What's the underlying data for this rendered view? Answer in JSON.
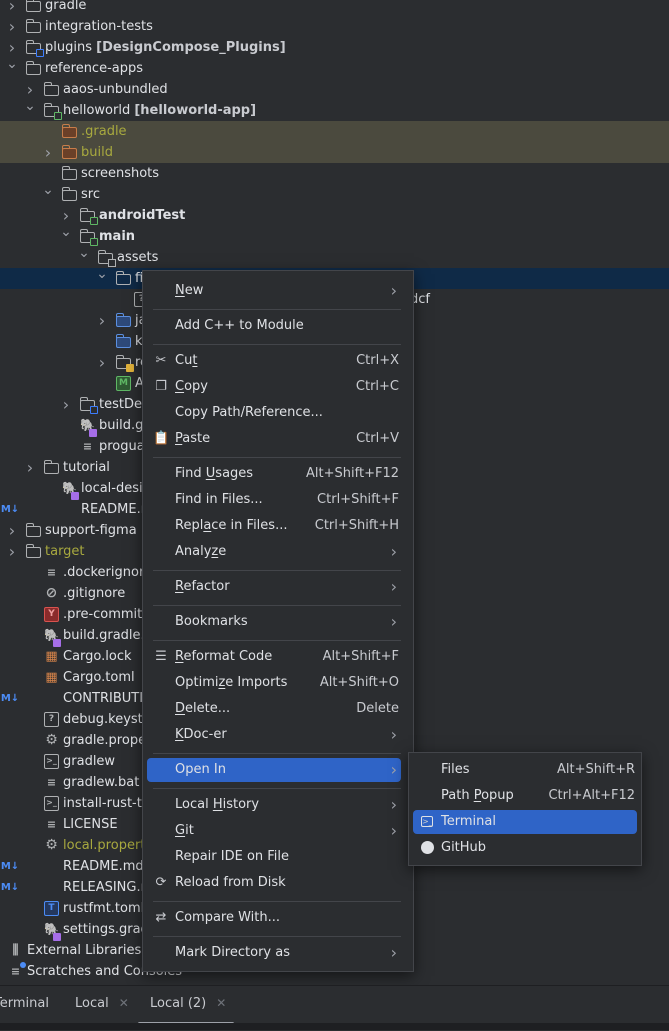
{
  "tree": {
    "rows": [
      {
        "label": "gradle",
        "indent": 0,
        "chevron": "right",
        "icon": "folder",
        "style": "normal"
      },
      {
        "label": "integration-tests",
        "indent": 0,
        "chevron": "right",
        "icon": "folder",
        "style": "normal"
      },
      {
        "label": "plugins",
        "module": "[DesignCompose_Plugins]",
        "indent": 0,
        "chevron": "right",
        "icon": "module-folder-blue",
        "style": "normal"
      },
      {
        "label": "reference-apps",
        "indent": 0,
        "chevron": "down",
        "icon": "folder",
        "style": "normal"
      },
      {
        "label": "aaos-unbundled",
        "indent": 1,
        "chevron": "right",
        "icon": "folder",
        "style": "normal"
      },
      {
        "label": "helloworld",
        "module": "[helloworld-app]",
        "indent": 1,
        "chevron": "down",
        "icon": "module-folder-green",
        "style": "normal"
      },
      {
        "label": ".gradle",
        "indent": 2,
        "chevron": "none",
        "icon": "folder-excluded",
        "style": "excluded"
      },
      {
        "label": "build",
        "indent": 2,
        "chevron": "right",
        "icon": "folder-excluded",
        "style": "excluded"
      },
      {
        "label": "screenshots",
        "indent": 2,
        "chevron": "none",
        "icon": "folder",
        "style": "normal"
      },
      {
        "label": "src",
        "indent": 2,
        "chevron": "down",
        "icon": "folder",
        "style": "normal"
      },
      {
        "label": "androidTest",
        "indent": 3,
        "chevron": "right",
        "icon": "module-folder-green",
        "style": "bold"
      },
      {
        "label": "main",
        "indent": 3,
        "chevron": "down",
        "icon": "module-folder-green",
        "style": "bold"
      },
      {
        "label": "assets",
        "indent": 4,
        "chevron": "down",
        "icon": "resource-folder",
        "style": "normal"
      },
      {
        "label": "fi",
        "indent": 5,
        "chevron": "down",
        "icon": "folder",
        "style": "selected"
      },
      {
        "label": "",
        "suffix": "dcf",
        "indent": 6,
        "chevron": "none",
        "icon": "unknown-file",
        "style": "normal"
      },
      {
        "label": "java",
        "indent": 5,
        "chevron": "right",
        "icon": "source-folder",
        "style": "normal"
      },
      {
        "label": "kotli",
        "indent": 5,
        "chevron": "none",
        "icon": "source-folder",
        "style": "normal"
      },
      {
        "label": "res",
        "indent": 5,
        "chevron": "right",
        "icon": "res-folder",
        "style": "normal"
      },
      {
        "label": "And",
        "indent": 5,
        "chevron": "none",
        "icon": "manifest-file",
        "style": "normal"
      },
      {
        "label": "testDel",
        "indent": 3,
        "chevron": "right",
        "icon": "module-folder-blue",
        "style": "normal"
      },
      {
        "label": "build.grad",
        "indent": 3,
        "chevron": "none",
        "icon": "gradle-kts-file",
        "style": "normal"
      },
      {
        "label": "proguard-",
        "indent": 3,
        "chevron": "none",
        "icon": "text-file",
        "style": "normal"
      },
      {
        "label": "tutorial",
        "indent": 1,
        "chevron": "right",
        "icon": "folder",
        "style": "normal"
      },
      {
        "label": "local-design-",
        "indent": 2,
        "chevron": "none",
        "icon": "gradle-kts-file",
        "style": "normal"
      },
      {
        "label": "README.md",
        "indent": 2,
        "chevron": "none",
        "icon": "markdown-file",
        "style": "normal"
      },
      {
        "label": "support-figma",
        "indent": 0,
        "chevron": "right",
        "icon": "folder",
        "style": "normal"
      },
      {
        "label": "target",
        "indent": 0,
        "chevron": "right",
        "icon": "folder",
        "style": "olive"
      },
      {
        "label": ".dockerignore",
        "indent": 1,
        "chevron": "none",
        "icon": "text-file",
        "style": "normal"
      },
      {
        "label": ".gitignore",
        "indent": 1,
        "chevron": "none",
        "icon": "ignore-file",
        "style": "normal"
      },
      {
        "label": ".pre-commit-co",
        "indent": 1,
        "chevron": "none",
        "icon": "yaml-file",
        "style": "normal"
      },
      {
        "label": "build.gradle.kts",
        "indent": 1,
        "chevron": "none",
        "icon": "gradle-kts-file",
        "style": "normal"
      },
      {
        "label": "Cargo.lock",
        "indent": 1,
        "chevron": "none",
        "icon": "cargo-lock-file",
        "style": "normal"
      },
      {
        "label": "Cargo.toml",
        "indent": 1,
        "chevron": "none",
        "icon": "cargo-file",
        "style": "normal"
      },
      {
        "label": "CONTRIBUTING",
        "indent": 1,
        "chevron": "none",
        "icon": "markdown-file",
        "style": "normal"
      },
      {
        "label": "debug.keystore",
        "indent": 1,
        "chevron": "none",
        "icon": "unknown-file",
        "style": "normal"
      },
      {
        "label": "gradle.propertie",
        "indent": 1,
        "chevron": "none",
        "icon": "gear-file",
        "style": "normal"
      },
      {
        "label": "gradlew",
        "indent": 1,
        "chevron": "none",
        "icon": "shell-file",
        "style": "normal"
      },
      {
        "label": "gradlew.bat",
        "indent": 1,
        "chevron": "none",
        "icon": "text-file",
        "style": "normal"
      },
      {
        "label": "install-rust-tool",
        "indent": 1,
        "chevron": "none",
        "icon": "shell-file",
        "style": "normal"
      },
      {
        "label": "LICENSE",
        "indent": 1,
        "chevron": "none",
        "icon": "text-file",
        "style": "normal"
      },
      {
        "label": "local.properties",
        "indent": 1,
        "chevron": "none",
        "icon": "gear-file",
        "style": "olive"
      },
      {
        "label": "README.md",
        "indent": 1,
        "chevron": "none",
        "icon": "markdown-file",
        "style": "normal"
      },
      {
        "label": "RELEASING.md",
        "indent": 1,
        "chevron": "none",
        "icon": "markdown-file",
        "style": "normal"
      },
      {
        "label": "rustfmt.toml",
        "indent": 1,
        "chevron": "none",
        "icon": "toml-file",
        "style": "normal"
      },
      {
        "label": "settings.gradle.",
        "indent": 1,
        "chevron": "none",
        "icon": "gradle-kts-file",
        "style": "normal"
      },
      {
        "label": "External Libraries",
        "indent": -1,
        "chevron": "none",
        "icon": "libraries",
        "style": "normal"
      },
      {
        "label": "Scratches and Consoles",
        "indent": -1,
        "chevron": "none",
        "icon": "scratches",
        "style": "normal"
      }
    ]
  },
  "context_menu": {
    "items": [
      {
        "type": "item",
        "label": "New",
        "mnemonic": 0,
        "submenu": true
      },
      {
        "type": "sep"
      },
      {
        "type": "item",
        "label": "Add C++ to Module"
      },
      {
        "type": "sep"
      },
      {
        "type": "item",
        "label": "Cut",
        "mnemonic": 2,
        "shortcut": "Ctrl+X",
        "icon": "scissors-icon"
      },
      {
        "type": "item",
        "label": "Copy",
        "mnemonic": 0,
        "shortcut": "Ctrl+C",
        "icon": "copy-icon"
      },
      {
        "type": "item",
        "label": "Copy Path/Reference..."
      },
      {
        "type": "item",
        "label": "Paste",
        "mnemonic": 0,
        "shortcut": "Ctrl+V",
        "icon": "paste-icon"
      },
      {
        "type": "sep"
      },
      {
        "type": "item",
        "label": "Find Usages",
        "mnemonic": 5,
        "shortcut": "Alt+Shift+F12"
      },
      {
        "type": "item",
        "label": "Find in Files...",
        "shortcut": "Ctrl+Shift+F"
      },
      {
        "type": "item",
        "label": "Replace in Files...",
        "mnemonic": 4,
        "shortcut": "Ctrl+Shift+H"
      },
      {
        "type": "item",
        "label": "Analyze",
        "mnemonic": 5,
        "submenu": true
      },
      {
        "type": "sep"
      },
      {
        "type": "item",
        "label": "Refactor",
        "mnemonic": 0,
        "submenu": true
      },
      {
        "type": "sep"
      },
      {
        "type": "item",
        "label": "Bookmarks",
        "submenu": true
      },
      {
        "type": "sep"
      },
      {
        "type": "item",
        "label": "Reformat Code",
        "mnemonic": 0,
        "shortcut": "Alt+Shift+F",
        "icon": "reformat-icon"
      },
      {
        "type": "item",
        "label": "Optimize Imports",
        "mnemonic": 6,
        "shortcut": "Alt+Shift+O"
      },
      {
        "type": "item",
        "label": "Delete...",
        "mnemonic": 0,
        "shortcut": "Delete"
      },
      {
        "type": "item",
        "label": "KDoc-er",
        "mnemonic": 0,
        "submenu": true
      },
      {
        "type": "sep"
      },
      {
        "type": "item",
        "label": "Open In",
        "submenu": true,
        "active": true
      },
      {
        "type": "sep"
      },
      {
        "type": "item",
        "label": "Local History",
        "mnemonic": 6,
        "submenu": true
      },
      {
        "type": "item",
        "label": "Git",
        "mnemonic": 0,
        "submenu": true
      },
      {
        "type": "item",
        "label": "Repair IDE on File"
      },
      {
        "type": "item",
        "label": "Reload from Disk",
        "icon": "reload-icon"
      },
      {
        "type": "sep"
      },
      {
        "type": "item",
        "label": "Compare With...",
        "icon": "compare-icon"
      },
      {
        "type": "sep"
      },
      {
        "type": "item",
        "label": "Mark Directory as",
        "submenu": true
      }
    ]
  },
  "open_in_submenu": {
    "items": [
      {
        "label": "Files",
        "shortcut": "Alt+Shift+R"
      },
      {
        "label": "Path Popup",
        "mnemonic": 5,
        "shortcut": "Ctrl+Alt+F12"
      },
      {
        "label": "Terminal",
        "icon": "terminal-icon",
        "active": true
      },
      {
        "label": "GitHub",
        "icon": "github-icon"
      }
    ]
  },
  "bottom_panel": {
    "title": "Terminal",
    "tabs": [
      {
        "label": "Local"
      },
      {
        "label": "Local (2)",
        "selected": true
      }
    ]
  },
  "colors": {
    "accent": "#2f64c7",
    "selection": "#0f2a47",
    "excluded": "#4b4a3e",
    "olive_text": "#a8a93f"
  }
}
